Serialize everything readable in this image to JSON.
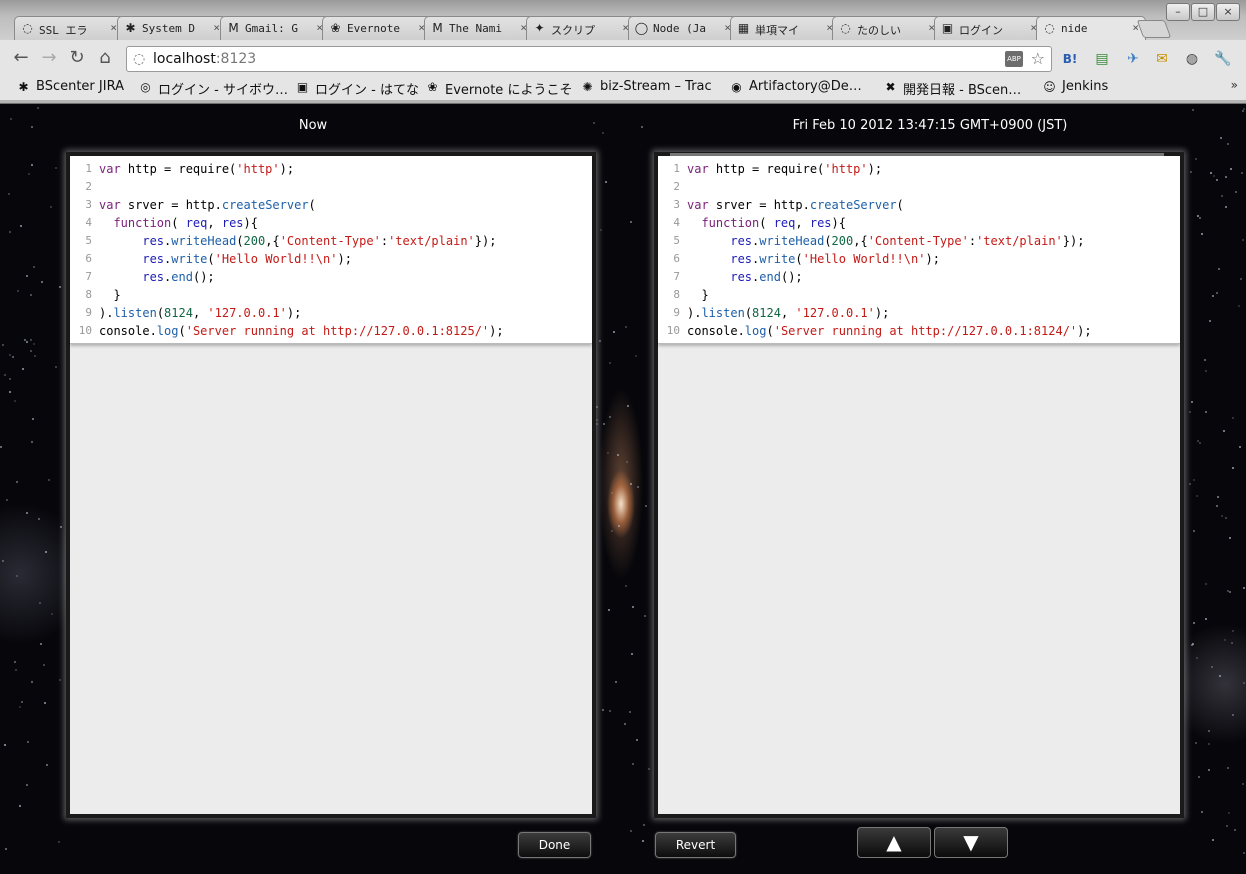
{
  "browser": {
    "tabs": [
      {
        "icon": "◌",
        "label": "SSL エラ"
      },
      {
        "icon": "✱",
        "label": "System D"
      },
      {
        "icon": "M",
        "label": "Gmail: G"
      },
      {
        "icon": "❀",
        "label": "Evernote"
      },
      {
        "icon": "M",
        "label": "The Nami"
      },
      {
        "icon": "✦",
        "label": "スクリプ"
      },
      {
        "icon": "◯",
        "label": "Node (Ja"
      },
      {
        "icon": "▦",
        "label": "単項マイ"
      },
      {
        "icon": "◌",
        "label": "たのしい"
      },
      {
        "icon": "▣",
        "label": "ログイン"
      },
      {
        "icon": "◌",
        "label": "nide"
      }
    ],
    "tab_close": "×",
    "window_buttons": [
      "–",
      "□",
      "×"
    ],
    "nav": {
      "back": "←",
      "forward": "→",
      "reload": "↻",
      "home": "⌂"
    },
    "address": {
      "host": "localhost",
      "port": ":8123"
    },
    "abp_label": "ABP",
    "star": "☆",
    "extensions": [
      "B!",
      "▤",
      "✈",
      "✉",
      "◍",
      "🔧"
    ],
    "bookmarks": [
      {
        "icon": "✱",
        "label": "BScenter JIRA"
      },
      {
        "icon": "◎",
        "label": "ログイン - サイボウ…"
      },
      {
        "icon": "▣",
        "label": "ログイン - はてな"
      },
      {
        "icon": "❀",
        "label": "Evernote にようこそ"
      },
      {
        "icon": "✺",
        "label": "biz-Stream – Trac"
      },
      {
        "icon": "◉",
        "label": "Artifactory@De…"
      },
      {
        "icon": "✖",
        "label": "開発日報 - BScen…"
      },
      {
        "icon": "☺",
        "label": "Jenkins"
      }
    ],
    "bookmarks_more": "»"
  },
  "diff": {
    "left_title": "Now",
    "right_title": "Fri Feb 10 2012 13:47:15 GMT+0900 (JST)",
    "left_lines": [
      {
        "n": "1",
        "code": "var http = require('http');"
      },
      {
        "n": "2",
        "code": ""
      },
      {
        "n": "3",
        "code": "var srver = http.createServer("
      },
      {
        "n": "4",
        "code": "  function( req, res){"
      },
      {
        "n": "5",
        "code": "      res.writeHead(200,{'Content-Type':'text/plain'});"
      },
      {
        "n": "6",
        "code": "      res.write('Hello World!!\\n');"
      },
      {
        "n": "7",
        "code": "      res.end();"
      },
      {
        "n": "8",
        "code": "  }"
      },
      {
        "n": "9",
        "code": ").listen(8124, '127.0.0.1');"
      },
      {
        "n": "10",
        "code": "console.log('Server running at http://127.0.0.1:8125/');"
      }
    ],
    "right_lines": [
      {
        "n": "1",
        "code": "var http = require('http');"
      },
      {
        "n": "2",
        "code": ""
      },
      {
        "n": "3",
        "code": "var srver = http.createServer("
      },
      {
        "n": "4",
        "code": "  function( req, res){"
      },
      {
        "n": "5",
        "code": "      res.writeHead(200,{'Content-Type':'text/plain'});"
      },
      {
        "n": "6",
        "code": "      res.write('Hello World!!\\n');"
      },
      {
        "n": "7",
        "code": "      res.end();"
      },
      {
        "n": "8",
        "code": "  }"
      },
      {
        "n": "9",
        "code": ").listen(8124, '127.0.0.1');"
      },
      {
        "n": "10",
        "code": "console.log('Server running at http://127.0.0.1:8124/');"
      }
    ],
    "done_label": "Done",
    "revert_label": "Revert",
    "up_label": "▲",
    "down_label": "▼"
  }
}
